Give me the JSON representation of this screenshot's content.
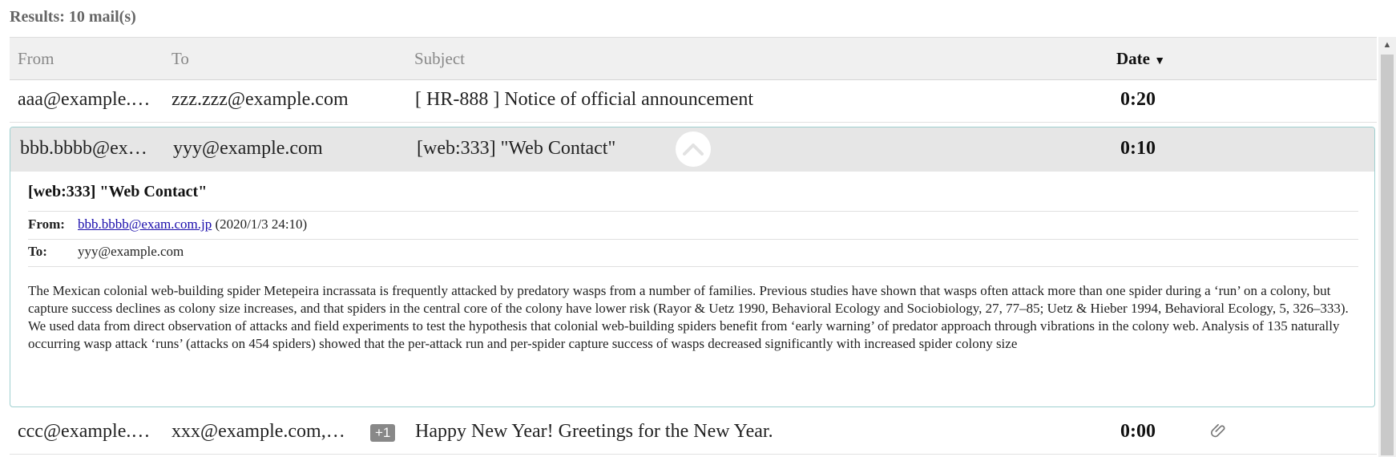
{
  "results_label": "Results: 10 mail(s)",
  "columns": {
    "from": "From",
    "to": "To",
    "subject": "Subject",
    "date": "Date"
  },
  "rows": [
    {
      "from": "aaa@example.c…",
      "to": "zzz.zzz@example.com",
      "subject": "[ HR-888 ] Notice of official announcement",
      "date": "0:20"
    },
    {
      "from": "bbb.bbbb@exa…",
      "to": "yyy@example.com",
      "subject": "[web:333] \"Web Contact\"",
      "date": "0:10"
    },
    {
      "from": "ccc@example.c…",
      "to": "xxx@example.com,x…",
      "to_extra_badge": "+1",
      "subject": "Happy New Year! Greetings for the New Year.",
      "date": "0:00",
      "has_attachment": true
    }
  ],
  "detail": {
    "subject": "[web:333] \"Web Contact\"",
    "from_label": "From:",
    "from_email": "bbb.bbbb@exam.com.jp",
    "from_datetime": "(2020/1/3 24:10)",
    "to_label": "To:",
    "to_email": "yyy@example.com",
    "body": "The Mexican colonial web-building spider Metepeira incrassata is frequently attacked by predatory wasps from a number of families. Previous studies have shown that wasps often attack more than one spider during a ‘run’ on a colony, but capture success declines as colony size increases, and that spiders in the central core of the colony have lower risk (Rayor & Uetz 1990, Behavioral Ecology and Sociobiology, 27, 77–85; Uetz & Hieber 1994, Behavioral Ecology, 5, 326–333). We used data from direct observation of attacks and field experiments to test the hypothesis that colonial web-building spiders benefit from ‘early warning’ of predator approach through vibrations in the colony web. Analysis of 135 naturally occurring wasp attack ‘runs’ (attacks on 454 spiders) showed that the per-attack run and per-spider capture success of wasps decreased significantly with increased spider colony size"
  },
  "icons": {
    "sort": "sort-desc-icon",
    "collapse": "chevron-up-icon",
    "attachment": "paperclip-icon",
    "scroll_up": "scroll-up-arrow-icon"
  }
}
